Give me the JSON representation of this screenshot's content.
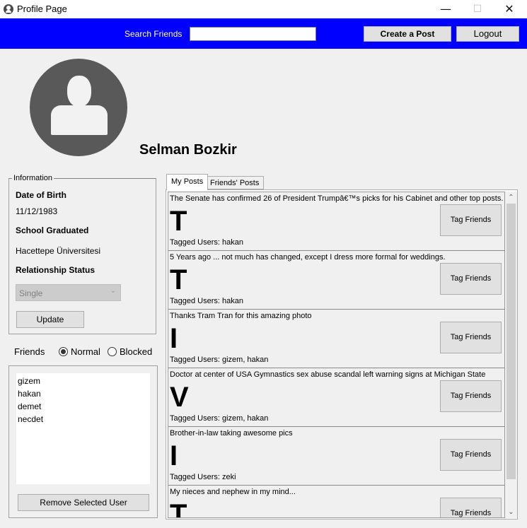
{
  "window": {
    "title": "Profile Page",
    "minimize": "—",
    "maximize": "☐",
    "close": "✕"
  },
  "header": {
    "search_label": "Search Friends",
    "search_value": "",
    "create_post_label": "Create a Post",
    "logout_label": "Logout",
    "accent_color": "#0000ff"
  },
  "profile": {
    "name": "Selman Bozkir"
  },
  "information": {
    "legend": "Information",
    "dob_label": "Date of Birth",
    "dob_value": "11/12/1983",
    "school_label": "School Graduated",
    "school_value": "Hacettepe Üniversitesi",
    "relationship_label": "Relationship Status",
    "relationship_value": "Single",
    "update_label": "Update"
  },
  "friends": {
    "label": "Friends",
    "filter_options": [
      "Normal",
      "Blocked"
    ],
    "filter_selected": "Normal",
    "list": [
      "gizem",
      "hakan",
      "demet",
      "necdet"
    ],
    "remove_label": "Remove Selected User"
  },
  "tabs": [
    {
      "label": "My Posts",
      "active": true
    },
    {
      "label": "Friends' Posts",
      "active": false
    }
  ],
  "posts": [
    {
      "text": "The Senate has confirmed 26 of President Trumpâ€™s picks for his Cabinet and other top posts.",
      "letter": "T",
      "tags": "Tagged Users: hakan",
      "button": "Tag Friends"
    },
    {
      "text": "5 Years ago ... not much has changed, except I dress more formal for weddings.",
      "letter": "T",
      "tags": "Tagged Users: hakan",
      "button": "Tag Friends"
    },
    {
      "text": "Thanks Tram Tran for this amazing photo",
      "letter": "I",
      "tags": "Tagged Users: gizem, hakan",
      "button": "Tag Friends"
    },
    {
      "text": "Doctor at center of USA Gymnastics sex abuse scandal left warning signs at Michigan State",
      "letter": "V",
      "tags": "Tagged Users: gizem, hakan",
      "button": "Tag Friends"
    },
    {
      "text": "Brother-in-law taking awesome pics",
      "letter": "I",
      "tags": "Tagged Users: zeki",
      "button": "Tag Friends"
    },
    {
      "text": "My nieces and nephew in my mind...",
      "letter": "T",
      "tags": "",
      "button": "Tag Friends"
    }
  ]
}
